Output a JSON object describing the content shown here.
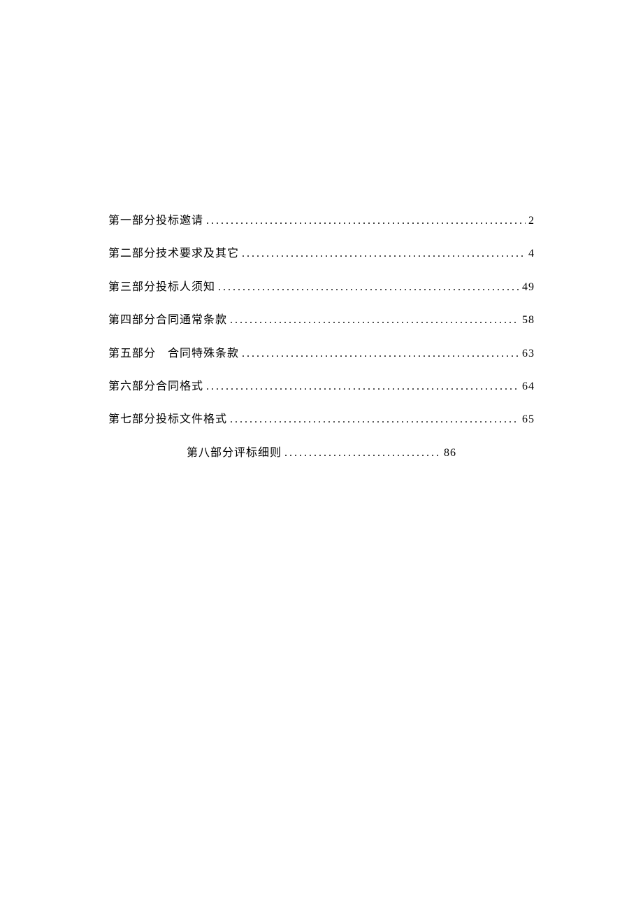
{
  "toc": {
    "entries": [
      {
        "title": "第一部分投标邀请",
        "page": "2"
      },
      {
        "title": "第二部分技术要求及其它",
        "page": "4"
      },
      {
        "title": "第三部分投标人须知",
        "page": "49"
      },
      {
        "title": "第四部分合同通常条款",
        "page": "58"
      },
      {
        "title": "第五部分　合同特殊条款",
        "page": "63"
      },
      {
        "title": "第六部分合同格式",
        "page": "64"
      },
      {
        "title": "第七部分投标文件格式",
        "page": "65"
      }
    ],
    "last_entry": {
      "title": "第八部分评标细则",
      "page": "86"
    }
  }
}
